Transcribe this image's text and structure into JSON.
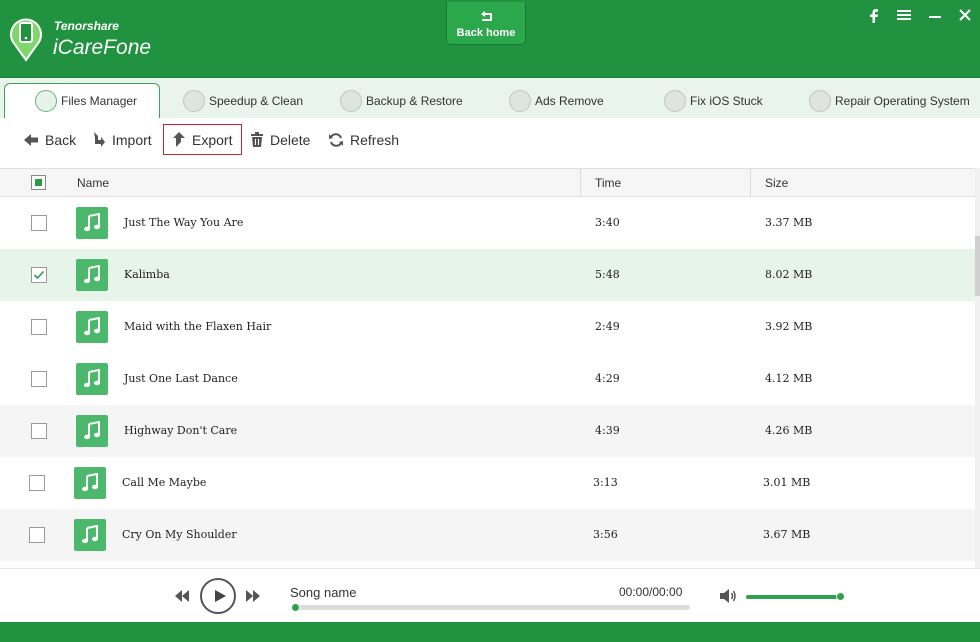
{
  "app": {
    "brand_small": "Tenorshare",
    "brand_big": "iCareFone",
    "back_home": "Back home",
    "accent_color": "#21923f",
    "window_controls": [
      "facebook-icon",
      "menu-icon",
      "minimize-icon",
      "close-icon"
    ]
  },
  "tabs": [
    {
      "label": "Files Manager",
      "icon": "files-icon",
      "active": true
    },
    {
      "label": "Speedup & Clean",
      "icon": "rocket-icon",
      "active": false
    },
    {
      "label": "Backup & Restore",
      "icon": "folder-icon",
      "active": false
    },
    {
      "label": "Ads Remove",
      "icon": "trash-icon",
      "active": false
    },
    {
      "label": "Fix iOS Stuck",
      "icon": "refresh-icon",
      "active": false
    },
    {
      "label": "Repair Operating System",
      "icon": "wrench-icon",
      "active": false
    }
  ],
  "toolbar": {
    "back": "Back",
    "import": "Import",
    "export": "Export",
    "delete": "Delete",
    "refresh": "Refresh"
  },
  "table": {
    "columns": {
      "name": "Name",
      "time": "Time",
      "size": "Size"
    },
    "rows": [
      {
        "name": "Just The Way You Are",
        "time": "3:40",
        "size": "3.37 MB",
        "checked": false
      },
      {
        "name": "Kalimba",
        "time": "5:48",
        "size": "8.02 MB",
        "checked": true
      },
      {
        "name": "Maid with the Flaxen Hair",
        "time": "2:49",
        "size": "3.92 MB",
        "checked": false
      },
      {
        "name": "Just One Last Dance",
        "time": "4:29",
        "size": "4.12 MB",
        "checked": false
      },
      {
        "name": "Highway Don't Care",
        "time": "4:39",
        "size": "4.26 MB",
        "checked": false
      },
      {
        "name": "Call Me Maybe",
        "time": "3:13",
        "size": "3.01 MB",
        "checked": false
      },
      {
        "name": "Cry On My Shoulder",
        "time": "3:56",
        "size": "3.67 MB",
        "checked": false
      }
    ]
  },
  "player": {
    "song_name": "Song name",
    "time": "00:00/00:00",
    "progress": 0,
    "volume": 1.0
  }
}
